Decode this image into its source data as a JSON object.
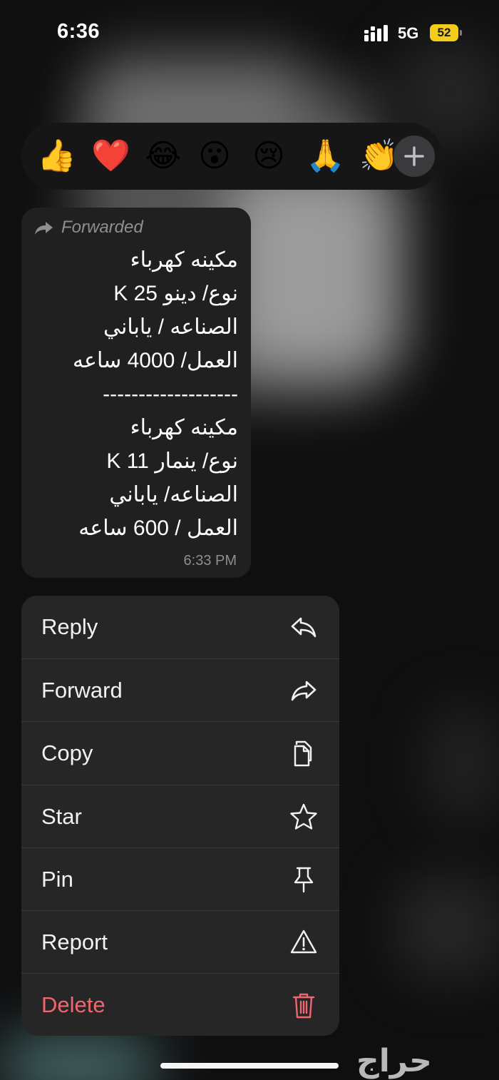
{
  "status_bar": {
    "time": "6:36",
    "network": "5G",
    "battery": "52"
  },
  "reactions": {
    "emojis": [
      "👍",
      "❤️",
      "😂",
      "😮",
      "😢",
      "🙏",
      "👏"
    ],
    "add_icon": "plus-icon"
  },
  "message": {
    "forwarded_label": "Forwarded",
    "lines": [
      "مكينه كهرباء",
      "نوع/ دينو 25 K",
      "الصناعه / ياباني",
      "العمل/ 4000 ساعه",
      "-------------------",
      "مكينه كهرباء",
      "نوع/ ينمار  11 K",
      "الصناعه/ ياباني",
      "العمل / 600 ساعه"
    ],
    "time": "6:33 PM"
  },
  "menu": {
    "items": [
      {
        "label": "Reply",
        "icon": "reply-icon"
      },
      {
        "label": "Forward",
        "icon": "forward-icon"
      },
      {
        "label": "Copy",
        "icon": "copy-icon"
      },
      {
        "label": "Star",
        "icon": "star-icon"
      },
      {
        "label": "Pin",
        "icon": "pin-icon"
      },
      {
        "label": "Report",
        "icon": "warning-icon"
      },
      {
        "label": "Delete",
        "icon": "trash-icon",
        "color": "#ef6670"
      }
    ]
  },
  "watermark": "حراج",
  "colors": {
    "accent_delete": "#ef6670",
    "battery": "#f4cd1a",
    "menu_bg": "#262627",
    "bubble_bg": "#202021"
  }
}
